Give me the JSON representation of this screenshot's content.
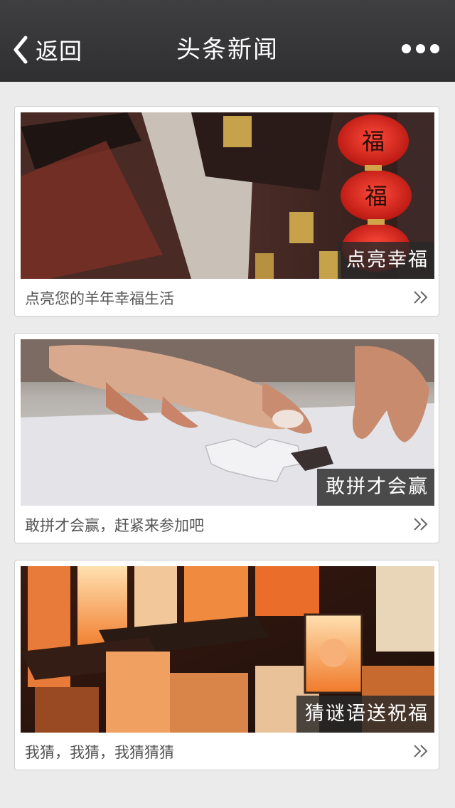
{
  "header": {
    "back_label": "返回",
    "title": "头条新闻"
  },
  "cards": [
    {
      "overlay": "点亮幸福",
      "caption": "点亮您的羊年幸福生活",
      "lantern_char": "福"
    },
    {
      "overlay": "敢拼才会赢",
      "caption": "敢拼才会赢，赶紧来参加吧"
    },
    {
      "overlay": "猜谜语送祝福",
      "caption": "我猜，我猜，我猜猜猜"
    }
  ],
  "colors": {
    "header_bg": "#38383a",
    "page_bg": "#ebebeb",
    "overlay_bg": "#282828",
    "lantern_red": "#d4261d"
  }
}
